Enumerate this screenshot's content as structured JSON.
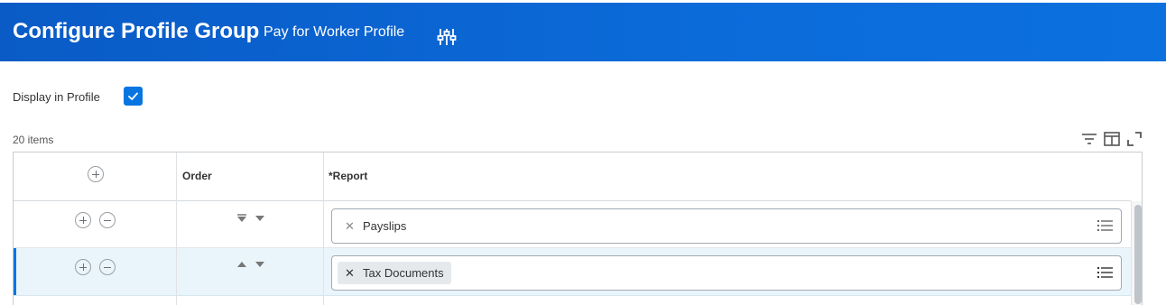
{
  "header": {
    "title": "Configure Profile Group",
    "subtitle": "Pay for Worker Profile",
    "tune_icon": "related-actions-sliders-icon"
  },
  "display_in_profile": {
    "label": "Display in Profile",
    "checked": true
  },
  "grid": {
    "count_text": "20 items",
    "toolbar_icons": [
      "filter-icon",
      "column-layout-icon",
      "fullscreen-icon"
    ],
    "columns": [
      "",
      "Order",
      "*Report"
    ],
    "rows": [
      {
        "report": "Payslips",
        "selected": false
      },
      {
        "report": "Tax Documents",
        "selected": true
      }
    ]
  },
  "colors": {
    "header_blue": "#0b6bd9",
    "accent": "#0875e1",
    "selected_row": "#eaf5fb"
  }
}
